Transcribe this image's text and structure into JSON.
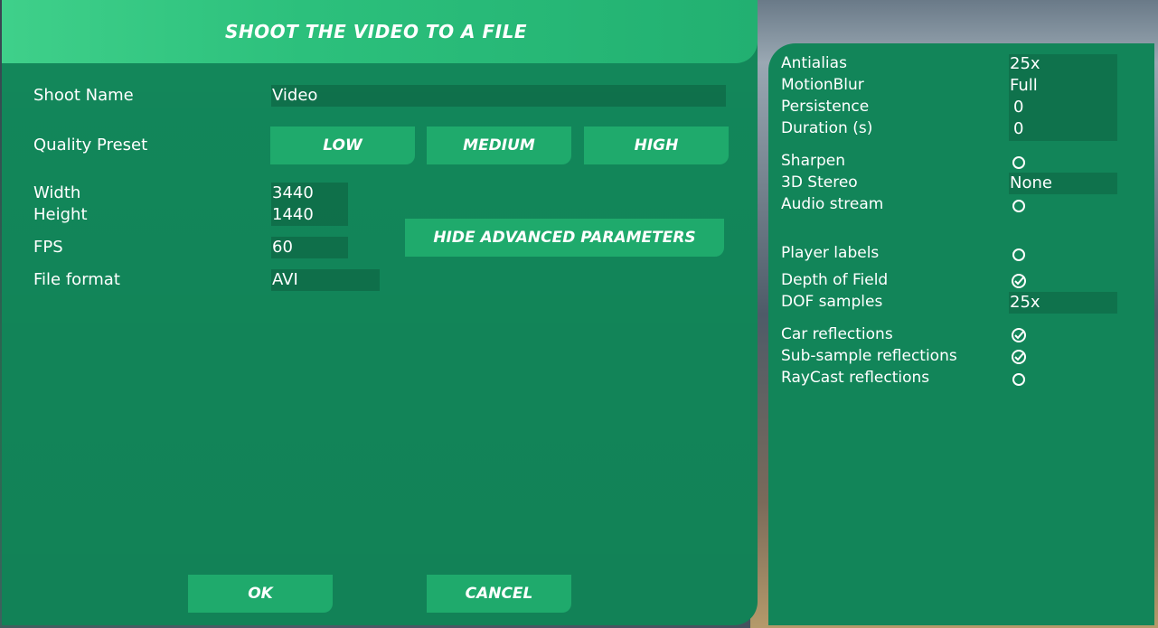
{
  "dialog": {
    "title": "SHOOT THE VIDEO TO A FILE"
  },
  "fields": {
    "shoot_name_label": "Shoot Name",
    "shoot_name_value": "Video",
    "quality_preset_label": "Quality Preset",
    "width_label": "Width",
    "width_value": "3440",
    "height_label": "Height",
    "height_value": "1440",
    "fps_label": "FPS",
    "fps_value": "60",
    "file_format_label": "File format",
    "file_format_value": "AVI"
  },
  "presets": {
    "low": "LOW",
    "medium": "MEDIUM",
    "high": "HIGH"
  },
  "advanced_button": "HIDE ADVANCED PARAMETERS",
  "footer": {
    "ok": "OK",
    "cancel": "CANCEL"
  },
  "advanced": {
    "antialias_label": "Antialias",
    "antialias_value": "25x",
    "motionblur_label": "MotionBlur",
    "motionblur_value": "Full",
    "persistence_label": "Persistence",
    "persistence_value": "0",
    "duration_label": "Duration (s)",
    "duration_value": "0",
    "sharpen_label": "Sharpen",
    "stereo_label": "3D Stereo",
    "stereo_value": "None",
    "audio_label": "Audio stream",
    "player_labels_label": "Player labels",
    "dof_label": "Depth of Field",
    "dof_samples_label": "DOF samples",
    "dof_samples_value": "25x",
    "car_reflections_label": "Car reflections",
    "subsample_reflections_label": "Sub-sample reflections",
    "raycast_reflections_label": "RayCast reflections"
  },
  "toggles": {
    "sharpen": false,
    "audio_stream": false,
    "player_labels": false,
    "depth_of_field": true,
    "car_reflections": true,
    "subsample_reflections": true,
    "raycast_reflections": false
  }
}
